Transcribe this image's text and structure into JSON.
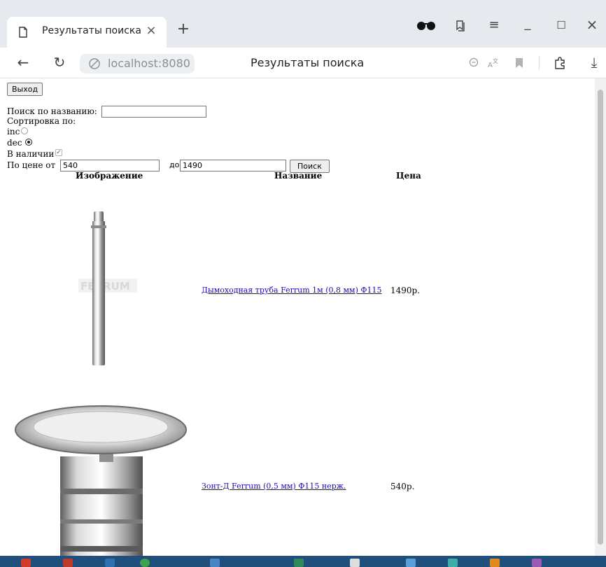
{
  "browser": {
    "tab_title": "Результаты поиска",
    "tab_close": "×",
    "new_tab": "+",
    "url": "localhost:8080",
    "page_title": "Результаты поиска",
    "icons": {
      "back": "←",
      "reload": "↻",
      "menu": "≡",
      "minimize": "_",
      "maximize": "☐",
      "close": "×",
      "download": "⤓"
    }
  },
  "page": {
    "logout_label": "Выход",
    "search_label": "Поиск по названию:",
    "search_value": "",
    "sort_label": "Сортировка по:",
    "sort_options": [
      {
        "label": "inc",
        "checked": false
      },
      {
        "label": "dec",
        "checked": true
      }
    ],
    "in_stock_label": "В наличии",
    "in_stock_checked": true,
    "price_from_label": "По цене от",
    "price_from": "540",
    "price_to_label": "до",
    "price_to": "1490",
    "search_button": "Поиск",
    "columns": [
      "Изображение",
      "Название",
      "Цена"
    ],
    "products": [
      {
        "name": "Дымоходная труба Ferrum 1м (0,8 мм) Ф115",
        "price": "1490р.",
        "image": "chimney-pipe-image"
      },
      {
        "name": "Зонт-Д Ferrum (0,5 мм) Ф115 нерж.",
        "price": "540р.",
        "image": "chimney-cap-image"
      }
    ]
  }
}
